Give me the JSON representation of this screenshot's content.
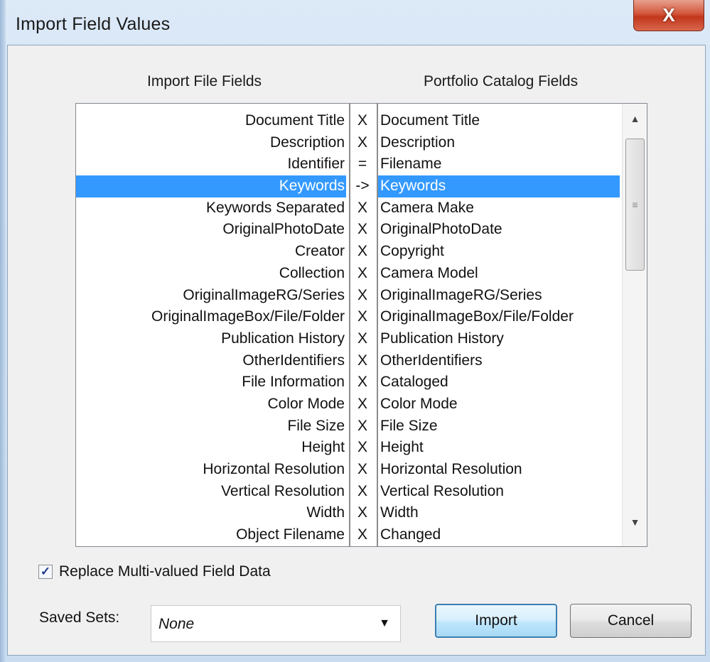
{
  "window": {
    "title": "Import Field Values",
    "close_label": "X"
  },
  "headers": {
    "import_fields": "Import File Fields",
    "catalog_fields": "Portfolio Catalog Fields"
  },
  "mapping": [
    {
      "import": "Document Title",
      "op": "X",
      "catalog": "Document Title"
    },
    {
      "import": "Description",
      "op": "X",
      "catalog": "Description"
    },
    {
      "import": "Identifier",
      "op": "=",
      "catalog": "Filename"
    },
    {
      "import": "Keywords",
      "op": "->",
      "catalog": "Keywords",
      "selected": true
    },
    {
      "import": "Keywords Separated",
      "op": "X",
      "catalog": "Camera Make"
    },
    {
      "import": "OriginalPhotoDate",
      "op": "X",
      "catalog": "OriginalPhotoDate"
    },
    {
      "import": "Creator",
      "op": "X",
      "catalog": "Copyright"
    },
    {
      "import": "Collection",
      "op": "X",
      "catalog": "Camera Model"
    },
    {
      "import": "OriginalImageRG/Series",
      "op": "X",
      "catalog": "OriginalImageRG/Series"
    },
    {
      "import": "OriginalImageBox/File/Folder",
      "op": "X",
      "catalog": "OriginalImageBox/File/Folder"
    },
    {
      "import": "Publication History",
      "op": "X",
      "catalog": "Publication History"
    },
    {
      "import": "OtherIdentifiers",
      "op": "X",
      "catalog": "OtherIdentifiers"
    },
    {
      "import": "File Information",
      "op": "X",
      "catalog": "Cataloged"
    },
    {
      "import": "Color Mode",
      "op": "X",
      "catalog": "Color Mode"
    },
    {
      "import": "File Size",
      "op": "X",
      "catalog": "File Size"
    },
    {
      "import": "Height",
      "op": "X",
      "catalog": "Height"
    },
    {
      "import": "Horizontal Resolution",
      "op": "X",
      "catalog": "Horizontal Resolution"
    },
    {
      "import": "Vertical Resolution",
      "op": "X",
      "catalog": "Vertical Resolution"
    },
    {
      "import": "Width",
      "op": "X",
      "catalog": "Width"
    },
    {
      "import": "Object Filename",
      "op": "X",
      "catalog": "Changed"
    }
  ],
  "scrollbar": {
    "up_icon": "▲",
    "down_icon": "▼",
    "grip_icon": "≡"
  },
  "options": {
    "replace_label": "Replace Multi-valued Field Data",
    "replace_checked": true,
    "check_glyph": "✓"
  },
  "saved_sets": {
    "label": "Saved Sets:",
    "value": "None",
    "arrow": "▼"
  },
  "buttons": {
    "import": "Import",
    "cancel": "Cancel"
  },
  "colors": {
    "selection": "#3399ff",
    "close": "#c1371c"
  }
}
